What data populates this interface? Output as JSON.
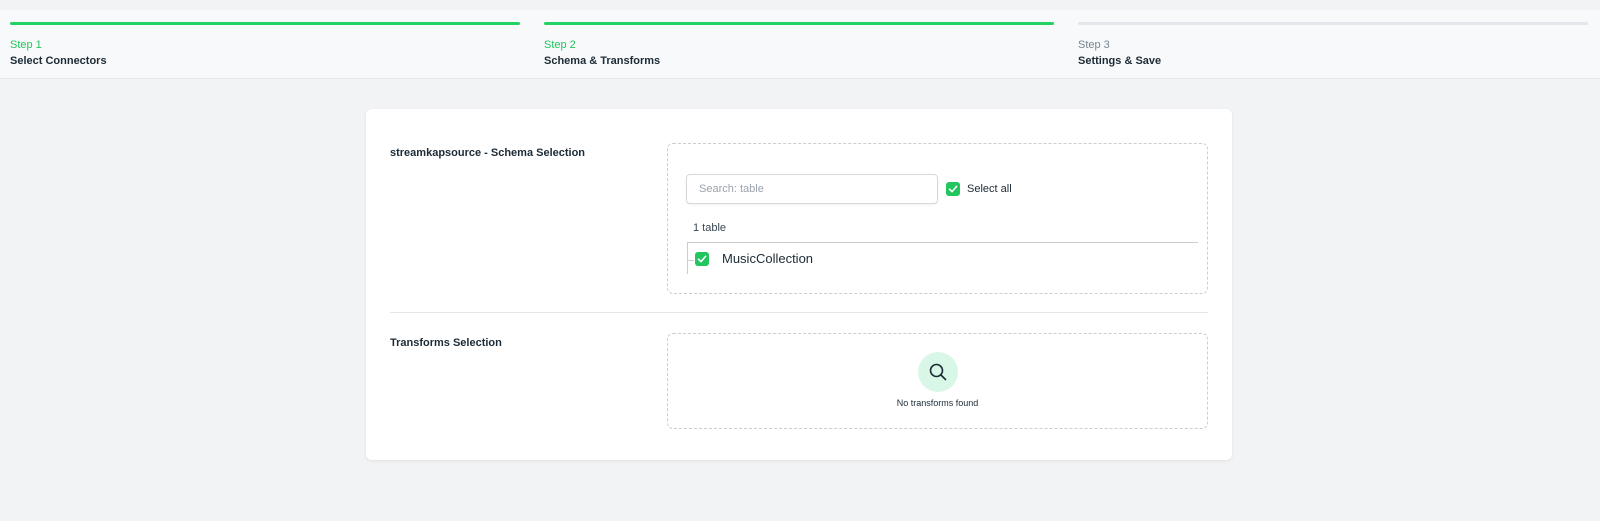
{
  "stepper": {
    "steps": [
      {
        "number": "Step 1",
        "title": "Select Connectors",
        "state": "done"
      },
      {
        "number": "Step 2",
        "title": "Schema & Transforms",
        "state": "active"
      },
      {
        "number": "Step 3",
        "title": "Settings & Save",
        "state": "pending"
      }
    ],
    "colors": {
      "complete": "#22d263",
      "pending": "#e3e6ea"
    }
  },
  "schema": {
    "label": "streamkapsource - Schema Selection",
    "search": {
      "placeholder": "Search: table",
      "value": ""
    },
    "select_all": {
      "label": "Select all",
      "checked": true
    },
    "count": "1 table",
    "tables": [
      {
        "name": "MusicCollection",
        "checked": true
      }
    ]
  },
  "transforms": {
    "label": "Transforms Selection",
    "empty_text": "No transforms found",
    "icon": "search-icon"
  },
  "colors": {
    "accent": "#22c55e",
    "accent_light": "#d9f7e6"
  }
}
